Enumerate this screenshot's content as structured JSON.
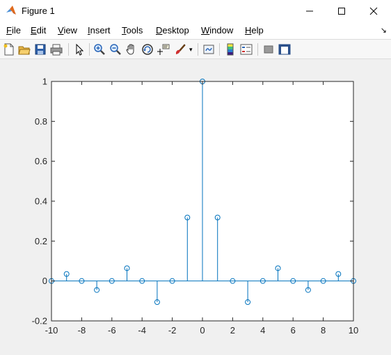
{
  "window": {
    "title": "Figure 1"
  },
  "menu": {
    "items": [
      "File",
      "Edit",
      "View",
      "Insert",
      "Tools",
      "Desktop",
      "Window",
      "Help"
    ]
  },
  "toolbar": {
    "icons": [
      "new-figure-icon",
      "open-file-icon",
      "save-icon",
      "print-icon",
      "pointer-icon",
      "zoom-in-icon",
      "zoom-out-icon",
      "pan-icon",
      "rotate-3d-icon",
      "data-cursor-icon",
      "brush-icon",
      "link-plot-icon",
      "colorbar-icon",
      "legend-icon",
      "hide-plot-tools-icon",
      "show-plot-tools-icon"
    ]
  },
  "chart_data": {
    "type": "stem",
    "x": [
      -10,
      -9,
      -8,
      -7,
      -6,
      -5,
      -4,
      -3,
      -2,
      -1,
      0,
      1,
      2,
      3,
      4,
      5,
      6,
      7,
      8,
      9,
      10
    ],
    "y": [
      0,
      0.035,
      0,
      -0.045,
      0,
      0.064,
      0,
      -0.106,
      0,
      0.318,
      1,
      0.318,
      0,
      -0.106,
      0,
      0.064,
      0,
      -0.045,
      0,
      0.035,
      0
    ],
    "xlim": [
      -10,
      10
    ],
    "ylim": [
      -0.2,
      1
    ],
    "xticks": [
      "-10",
      "-8",
      "-6",
      "-4",
      "-2",
      "0",
      "2",
      "4",
      "6",
      "8",
      "10"
    ],
    "yticks": [
      "-0.2",
      "0",
      "0.2",
      "0.4",
      "0.6",
      "0.8",
      "1"
    ],
    "color": "#0072bd",
    "grid": false
  }
}
